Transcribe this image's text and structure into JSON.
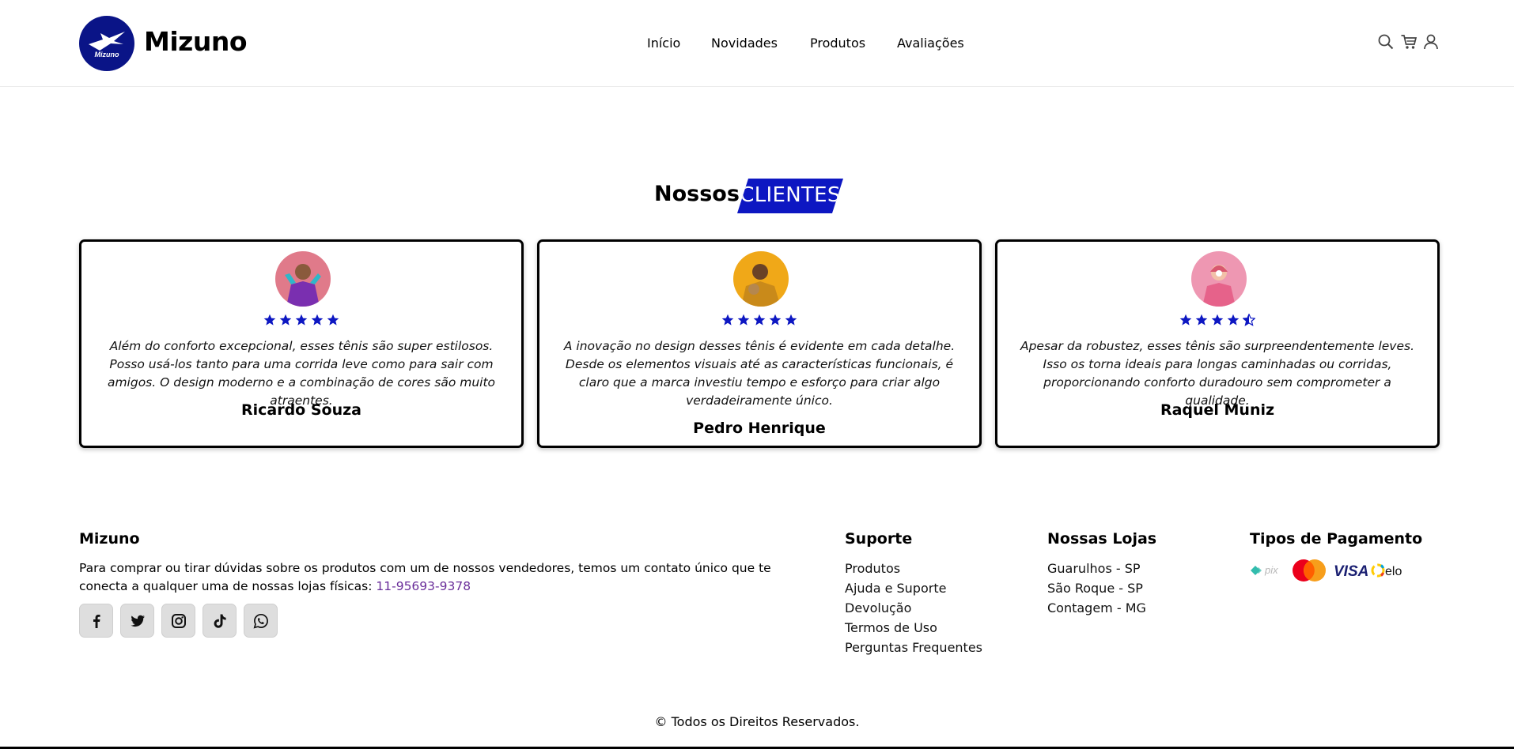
{
  "brand": {
    "name": "Mizuno",
    "logo_text": "Mizuno"
  },
  "nav": {
    "items": [
      "Início",
      "Novidades",
      "Produtos",
      "Avaliações"
    ]
  },
  "header_icons": [
    "search-icon",
    "cart-icon",
    "user-icon"
  ],
  "section": {
    "title_word": "Nossos",
    "title_tag": "CLIENTES"
  },
  "reviews": [
    {
      "rating": 5,
      "text": "Além do conforto excepcional, esses tênis são super estilosos. Posso usá-los tanto para uma corrida leve como para sair com amigos. O design moderno e a combinação de cores são muito atraentes.",
      "name": "Ricardo Souza"
    },
    {
      "rating": 5,
      "text": "A inovação no design desses tênis é evidente em cada detalhe. Desde os elementos visuais até as características funcionais, é claro que a marca investiu tempo e esforço para criar algo verdadeiramente único.",
      "name": "Pedro Henrique"
    },
    {
      "rating": 4.5,
      "text": "Apesar da robustez, esses tênis são surpreendentemente leves. Isso os torna ideais para longas caminhadas ou corridas, proporcionando conforto duradouro sem comprometer a qualidade.",
      "name": "Raquel Muniz"
    }
  ],
  "footer": {
    "about": {
      "heading": "Mizuno",
      "text": "Para comprar ou tirar dúvidas sobre os produtos com um de nossos vendedores, temos um contato único que te conecta a qualquer uma de nossas lojas físicas:",
      "phone": "11-95693-9378"
    },
    "social": [
      "facebook-icon",
      "twitter-icon",
      "instagram-icon",
      "tiktok-icon",
      "whatsapp-icon"
    ],
    "support": {
      "heading": "Suporte",
      "links": [
        "Produtos",
        "Ajuda e Suporte",
        "Devolução",
        "Termos de Uso",
        "Perguntas Frequentes"
      ]
    },
    "stores": {
      "heading": "Nossas Lojas",
      "links": [
        "Guarulhos - SP",
        "São Roque - SP",
        "Contagem - MG"
      ]
    },
    "payment": {
      "heading": "Tipos de Pagamento",
      "methods": [
        "pix",
        "mastercard",
        "VISA",
        "elo"
      ]
    },
    "copyright": "© Todos os Direitos Reservados."
  },
  "colors": {
    "accent": "#0d17c2",
    "logo_bg": "#0a1487",
    "star": "#0d17c2",
    "phone_link": "#6a2e9a"
  }
}
